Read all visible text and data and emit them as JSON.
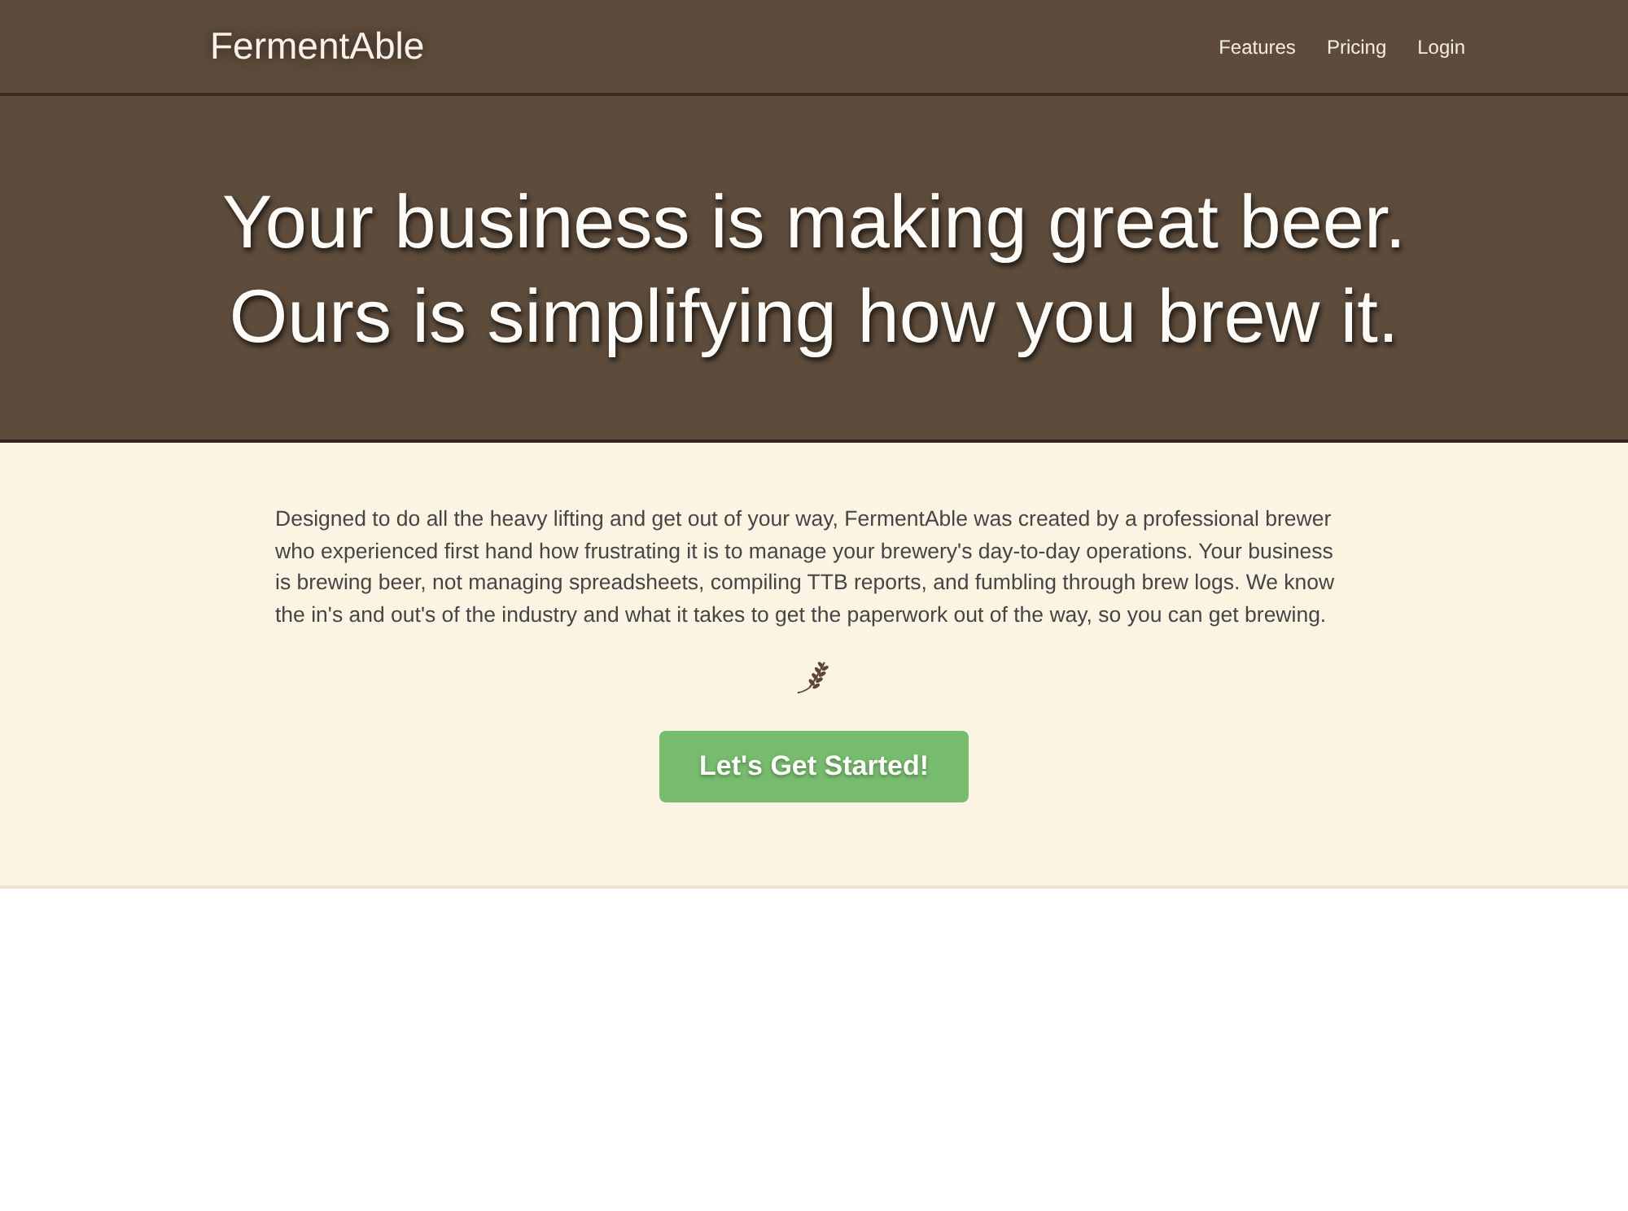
{
  "navbar": {
    "brand": "FermentAble",
    "links": [
      "Features",
      "Pricing",
      "Login"
    ]
  },
  "hero": {
    "headline": [
      "Your business is making great beer.",
      "Ours is simplifying how you brew it."
    ]
  },
  "intro": {
    "paragraph": "Designed to do all the heavy lifting and get out of your way, FermentAble was created by a professional brewer who experienced first hand how frustrating it is to manage your brewery's day-to-day operations. Your business is brewing beer, not managing spreadsheets, compiling TTB reports, and fumbling through brew logs. We know the in's and out's of the industry and what it takes to get the paperwork out of the way, so you can get brewing.",
    "cta_button": "Let's Get Started!"
  }
}
